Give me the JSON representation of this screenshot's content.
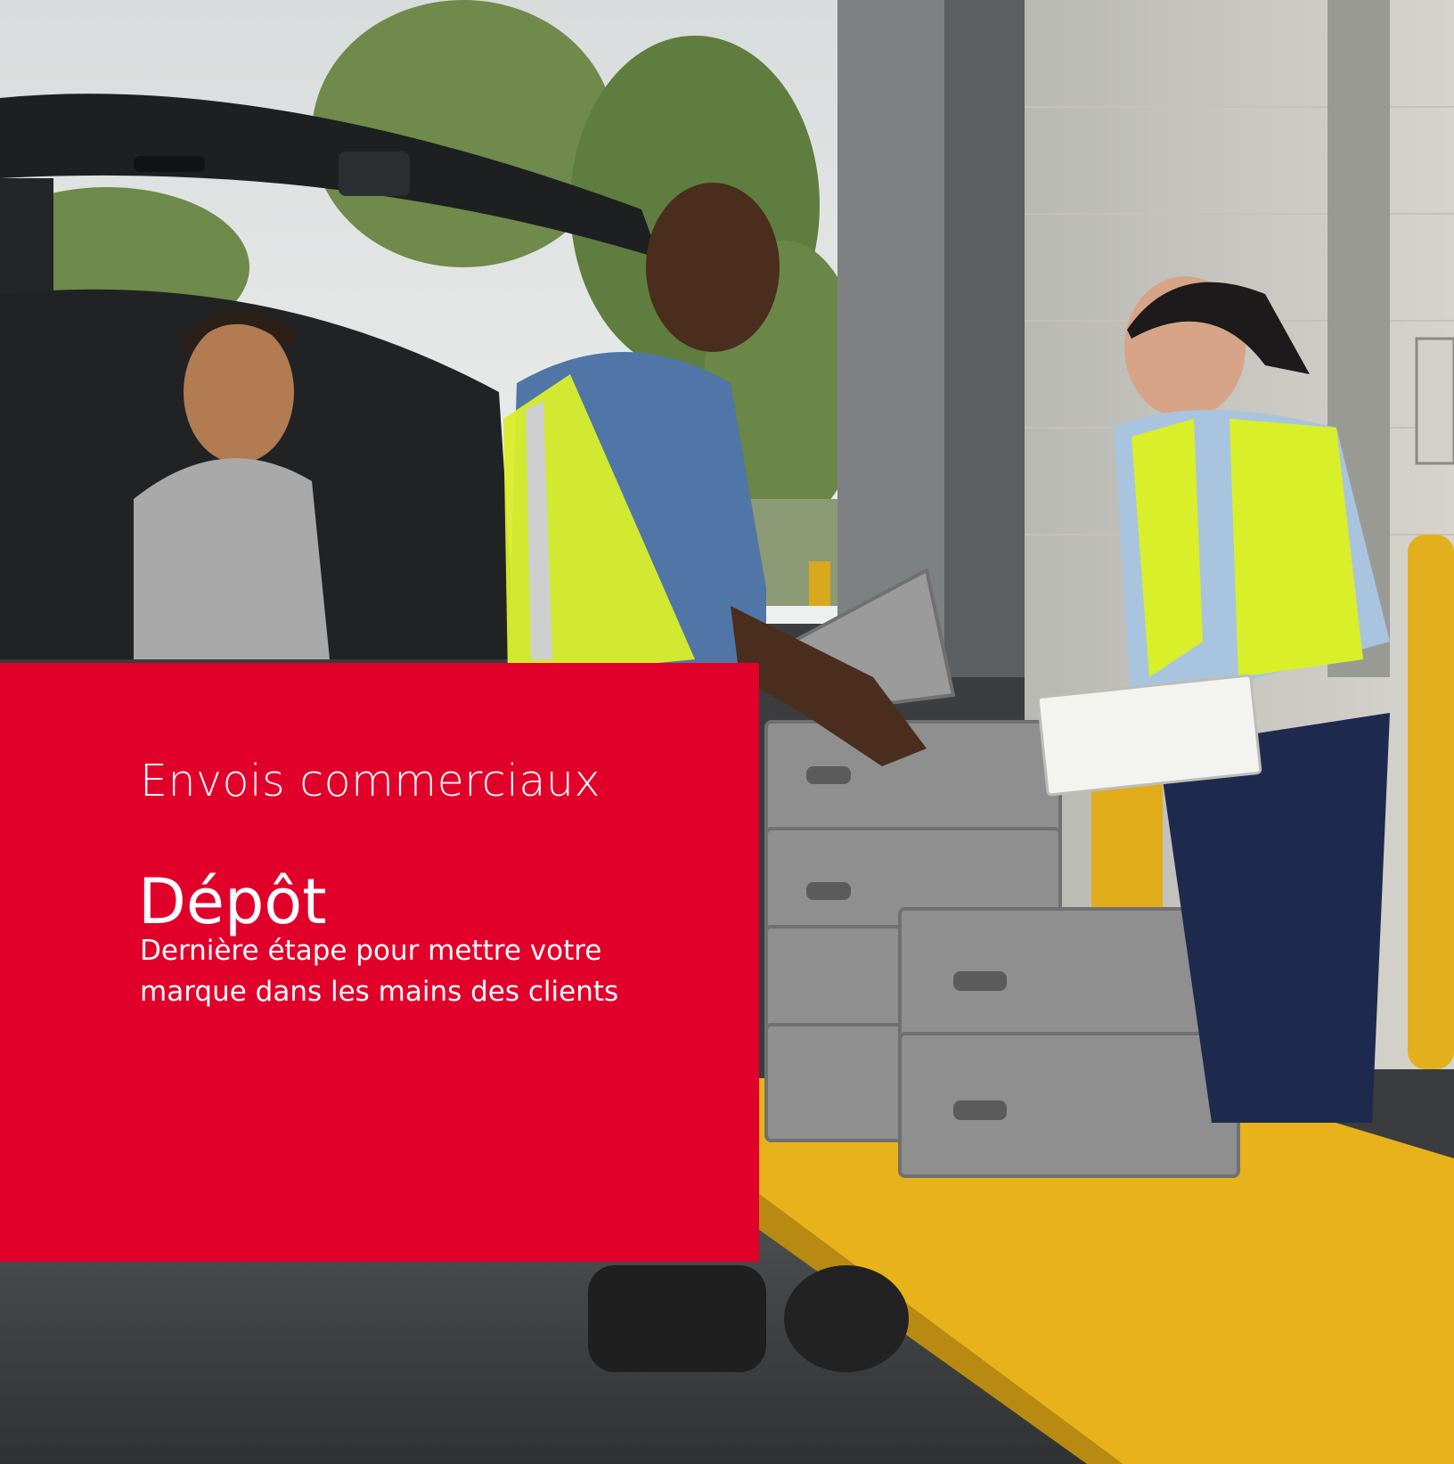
{
  "hero": {
    "eyebrow": "Envois commerciaux",
    "title": "Dépôt",
    "tagline_line1": "Dernière étape pour mettre votre",
    "tagline_line2": "marque dans les mains des clients"
  },
  "photo": {
    "scene": "loading-dock-drop-off",
    "icons": [
      "person-icon",
      "crate-icon",
      "cart-icon",
      "car-icon"
    ]
  },
  "colors": {
    "brand_red": "#e1002a",
    "text": "#ffffff",
    "vest_yellow": "#d9ef2a",
    "cart_yellow": "#e7b21a",
    "crate_gray": "#8e8f8e"
  }
}
